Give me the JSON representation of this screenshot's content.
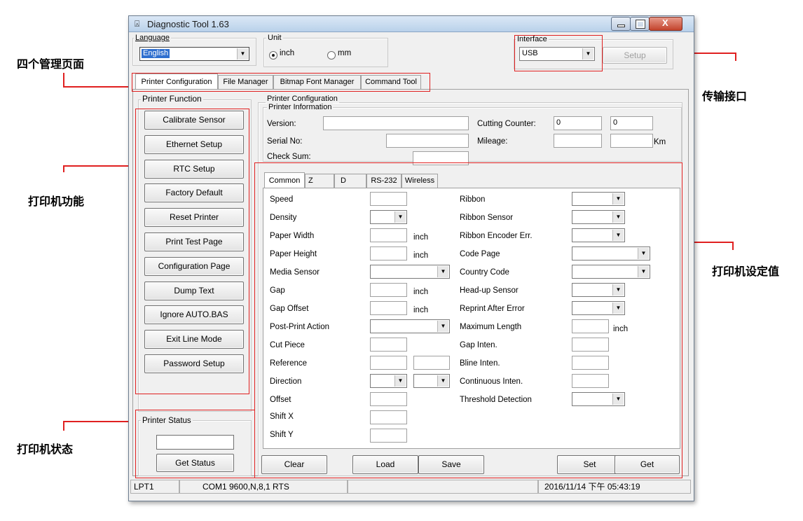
{
  "annotations": {
    "left_top": "四个管理页面",
    "right_top": "传输接口",
    "left_mid": "打印机功能",
    "right_mid": "打印机设定值",
    "left_bottom": "打印机状态"
  },
  "window": {
    "title": "Diagnostic Tool 1.63",
    "language_label": "Language",
    "language_value": "English",
    "unit_label": "Unit",
    "unit_options": [
      "inch",
      "mm"
    ],
    "unit_selected": "inch",
    "interface_label": "Interface",
    "interface_value": "USB",
    "setup_button": "Setup"
  },
  "main_tabs": [
    "Printer Configuration",
    "File Manager",
    "Bitmap Font Manager",
    "Command Tool"
  ],
  "printer_function": {
    "title": "Printer Function",
    "buttons": [
      "Calibrate Sensor",
      "Ethernet Setup",
      "RTC Setup",
      "Factory Default",
      "Reset Printer",
      "Print Test Page",
      "Configuration Page",
      "Dump Text",
      "Ignore AUTO.BAS",
      "Exit Line Mode",
      "Password Setup"
    ]
  },
  "printer_status": {
    "title": "Printer Status",
    "value": "",
    "get_status_button": "Get Status"
  },
  "printer_configuration": {
    "title": "Printer Configuration",
    "info_title": "Printer Information",
    "version_label": "Version:",
    "serial_label": "Serial No:",
    "checksum_label": "Check Sum:",
    "cutting_counter_label": "Cutting Counter:",
    "cutting_counter_values": [
      "0",
      "0"
    ],
    "mileage_label": "Mileage:",
    "mileage_unit": "Km"
  },
  "config_tabs": [
    "Common",
    "Z",
    "D",
    "RS-232",
    "Wireless"
  ],
  "common_left": {
    "speed": "Speed",
    "density": "Density",
    "paper_width": "Paper Width",
    "paper_height": "Paper Height",
    "media_sensor": "Media Sensor",
    "gap": "Gap",
    "gap_offset": "Gap Offset",
    "post_print": "Post-Print Action",
    "cut_piece": "Cut Piece",
    "reference": "Reference",
    "direction": "Direction",
    "offset": "Offset",
    "shift_x": "Shift X",
    "shift_y": "Shift Y",
    "inch": "inch"
  },
  "common_right": {
    "ribbon": "Ribbon",
    "ribbon_sensor": "Ribbon Sensor",
    "ribbon_encoder": "Ribbon Encoder Err.",
    "code_page": "Code Page",
    "country_code": "Country Code",
    "headup_sensor": "Head-up Sensor",
    "reprint_after_error": "Reprint After Error",
    "maximum_length": "Maximum Length",
    "gap_inten": "Gap Inten.",
    "bline_inten": "Bline Inten.",
    "continuous_inten": "Continuous Inten.",
    "threshold": "Threshold Detection",
    "inch": "inch"
  },
  "bottom_buttons": [
    "Clear",
    "Load",
    "Save",
    "Set",
    "Get"
  ],
  "statusbar": {
    "port": "LPT1",
    "com": "COM1 9600,N,8,1 RTS",
    "middle": "",
    "datetime": "2016/11/14 下午 05:43:19"
  },
  "colors": {
    "annotation": "#e02020",
    "titlebar": "#c9dcf0",
    "window_bg": "#f0f0f0"
  }
}
